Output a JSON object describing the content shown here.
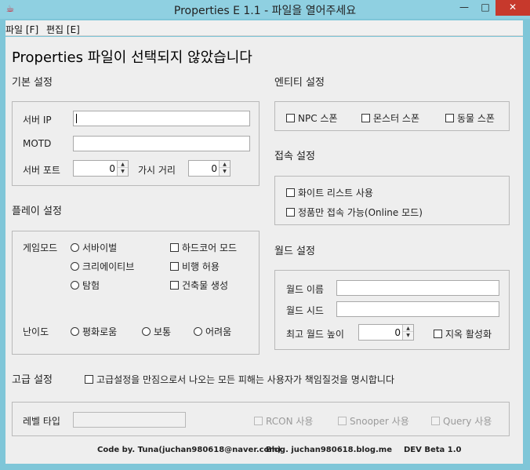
{
  "window": {
    "title": "Properties E 1.1 - 파일을 열어주세요",
    "min_glyph": "—",
    "max_glyph": "□",
    "close_glyph": "✕"
  },
  "menu": {
    "file": "파일 [F]",
    "edit": "편집 [E]"
  },
  "heading": "Properties 파일이 선택되지 않았습니다",
  "basic": {
    "section": "기본 설정",
    "server_ip_label": "서버 IP",
    "server_ip_value": "",
    "motd_label": "MOTD",
    "motd_value": "",
    "server_port_label": "서버 포트",
    "server_port_value": "0",
    "view_distance_label": "가시 거리",
    "view_distance_value": "0"
  },
  "entity": {
    "section": "엔티티 설정",
    "npc": "NPC 스폰",
    "monster": "몬스터 스폰",
    "animal": "동물 스폰"
  },
  "connection": {
    "section": "접속 설정",
    "whitelist": "화이트 리스트 사용",
    "online_mode": "정품만 접속 가능(Online 모드)"
  },
  "play": {
    "section": "플레이 설정",
    "gamemode_label": "게임모드",
    "survival": "서바이벌",
    "creative": "크리에이티브",
    "adventure": "탐험",
    "hardcore": "하드코어 모드",
    "allow_flight": "비행 허용",
    "generate_structures": "건축물 생성",
    "difficulty_label": "난이도",
    "peaceful": "평화로움",
    "normal": "보통",
    "hard": "어려움"
  },
  "world": {
    "section": "월드 설정",
    "name_label": "월드 이름",
    "name_value": "",
    "seed_label": "월드 시드",
    "seed_value": "",
    "max_height_label": "최고 월드 높이",
    "max_height_value": "0",
    "nether": "지옥 활성화"
  },
  "advanced": {
    "section": "고급 설정",
    "agree": "고급설정을 만짐으로서 나오는 모든 피해는 사용자가 책임질것을 명시합니다",
    "level_type_label": "레벨 타입",
    "level_type_value": "",
    "rcon": "RCON 사용",
    "snooper": "Snooper 사용",
    "query": "Query 사용"
  },
  "footer": {
    "code_by": "Code by. Tuna(juchan980618@naver.com)",
    "blog": "Blog. juchan980618.blog.me",
    "version": "DEV Beta 1.0"
  }
}
